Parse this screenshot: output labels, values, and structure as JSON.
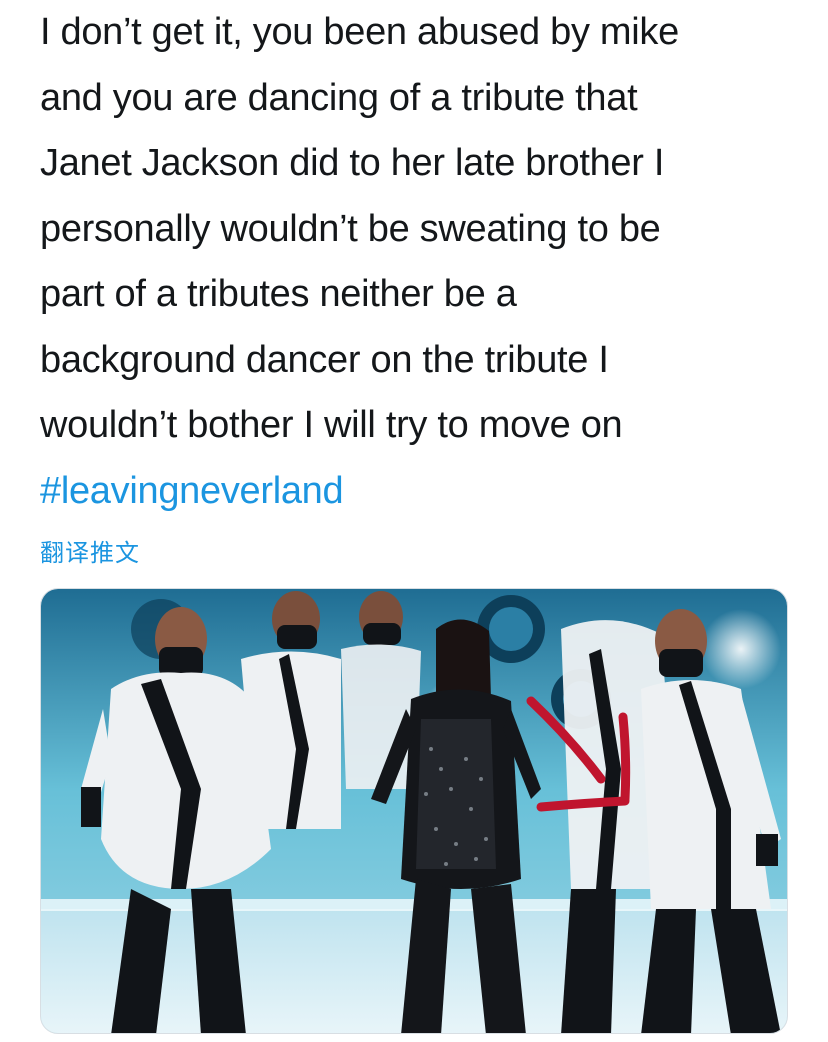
{
  "tweet": {
    "lines": [
      "I don’t get it, you been abused by mike",
      "and you are dancing of a tribute that",
      "Janet Jackson did to her late brother I",
      "personally wouldn’t be sweating to be",
      "part of a tributes neither be a",
      "background dancer on the tribute I",
      "wouldn’t bother I will try to move on"
    ],
    "hashtag": "#leavingneverland",
    "translate_label": "翻译推文"
  },
  "media": {
    "description_icon": "stage-photo",
    "annotation_icon": "red-arrow-icon",
    "colors": {
      "background": "#6ec3dc",
      "stage_floor": "#d9eef5",
      "jacket_white": "#eef1f3",
      "jacket_black": "#111418",
      "arrow": "#c0152e"
    }
  }
}
